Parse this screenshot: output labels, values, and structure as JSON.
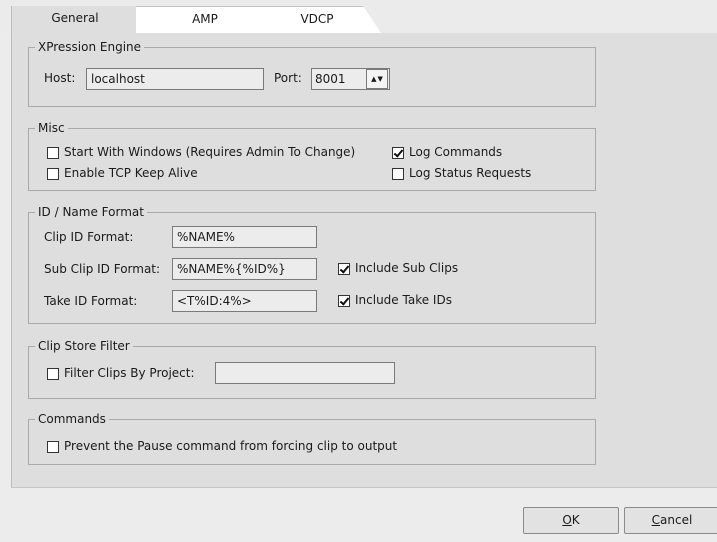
{
  "tabs": [
    {
      "label": "General",
      "active": true
    },
    {
      "label": "AMP",
      "active": false
    },
    {
      "label": "VDCP",
      "active": false
    }
  ],
  "engine": {
    "legend": "XPression Engine",
    "host_label": "Host:",
    "host_value": "localhost",
    "port_label": "Port:",
    "port_value": "8001"
  },
  "misc": {
    "legend": "Misc",
    "start_with_windows": {
      "label": "Start With Windows (Requires Admin To Change)",
      "checked": false
    },
    "log_commands": {
      "label": "Log Commands",
      "checked": true
    },
    "tcp_keep_alive": {
      "label": "Enable TCP Keep Alive",
      "checked": false
    },
    "log_status": {
      "label": "Log Status Requests",
      "checked": false
    }
  },
  "id_format": {
    "legend": "ID / Name Format",
    "clip_label": "Clip ID Format:",
    "clip_value": "%NAME%",
    "sub_label": "Sub Clip ID Format:",
    "sub_value": "%NAME%{%ID%}",
    "include_sub": {
      "label": "Include Sub Clips",
      "checked": true
    },
    "take_label": "Take ID Format:",
    "take_value": "<T%ID:4%>",
    "include_take": {
      "label": "Include Take IDs",
      "checked": true
    }
  },
  "filter": {
    "legend": "Clip Store Filter",
    "label": "Filter Clips By Project:",
    "checked": false,
    "value": ""
  },
  "commands": {
    "legend": "Commands",
    "prevent_pause": {
      "label": "Prevent the Pause command from forcing clip to output",
      "checked": false
    }
  },
  "buttons": {
    "ok_mnemonic": "O",
    "ok_rest": "K",
    "cancel_mnemonic": "C",
    "cancel_rest": "ancel"
  }
}
